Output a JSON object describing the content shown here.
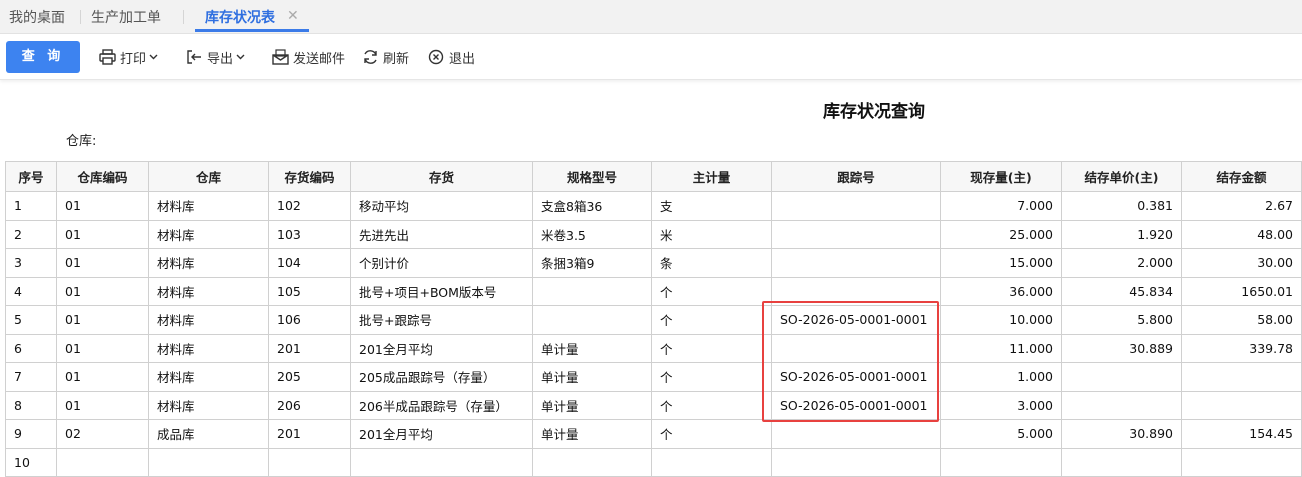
{
  "tabs": [
    {
      "label": "我的桌面",
      "active": false
    },
    {
      "label": "生产加工单",
      "active": false
    },
    {
      "label": "库存状况表",
      "active": true
    }
  ],
  "toolbar": {
    "query_label": "查 询",
    "print_label": "打印",
    "export_label": "导出",
    "email_label": "发送邮件",
    "refresh_label": "刷新",
    "exit_label": "退出"
  },
  "report": {
    "title": "库存状况查询",
    "warehouse_label": "仓库:"
  },
  "columns": [
    "序号",
    "仓库编码",
    "仓库",
    "存货编码",
    "存货",
    "规格型号",
    "主计量",
    "跟踪号",
    "现存量(主)",
    "结存单价(主)",
    "结存金额"
  ],
  "rows": [
    [
      "1",
      "01",
      "材料库",
      "102",
      "移动平均",
      "支盒8箱36",
      "支",
      "",
      "7.000",
      "0.381",
      "2.67"
    ],
    [
      "2",
      "01",
      "材料库",
      "103",
      "先进先出",
      "米卷3.5",
      "米",
      "",
      "25.000",
      "1.920",
      "48.00"
    ],
    [
      "3",
      "01",
      "材料库",
      "104",
      "个别计价",
      "条捆3箱9",
      "条",
      "",
      "15.000",
      "2.000",
      "30.00"
    ],
    [
      "4",
      "01",
      "材料库",
      "105",
      "批号+项目+BOM版本号",
      "",
      "个",
      "",
      "36.000",
      "45.834",
      "1650.01"
    ],
    [
      "5",
      "01",
      "材料库",
      "106",
      "批号+跟踪号",
      "",
      "个",
      "SO-2026-05-0001-0001",
      "10.000",
      "5.800",
      "58.00"
    ],
    [
      "6",
      "01",
      "材料库",
      "201",
      "201全月平均",
      "单计量",
      "个",
      "",
      "11.000",
      "30.889",
      "339.78"
    ],
    [
      "7",
      "01",
      "材料库",
      "205",
      "205成品跟踪号（存量）",
      "单计量",
      "个",
      "SO-2026-05-0001-0001",
      "1.000",
      "",
      ""
    ],
    [
      "8",
      "01",
      "材料库",
      "206",
      "206半成品跟踪号（存量）",
      "单计量",
      "个",
      "SO-2026-05-0001-0001",
      "3.000",
      "",
      ""
    ],
    [
      "9",
      "02",
      "成品库",
      "201",
      "201全月平均",
      "单计量",
      "个",
      "",
      "5.000",
      "30.890",
      "154.45"
    ],
    [
      "10",
      "",
      "",
      "",
      "",
      "",
      "",
      "",
      "",
      "",
      ""
    ]
  ],
  "colors": {
    "accent": "#3d83f0",
    "value_blue": "#1f3fe0",
    "highlight_red": "#e8413f"
  }
}
